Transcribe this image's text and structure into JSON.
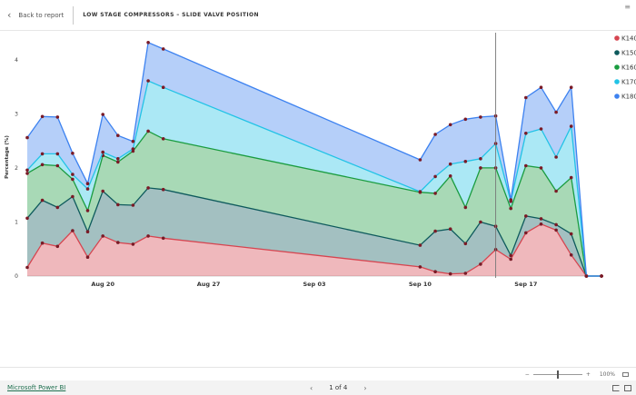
{
  "header": {
    "back_label": "Back to report",
    "title": "LOW STAGE COMPRESSORS – SLIDE VALVE POSITION"
  },
  "footer": {
    "brand_link": "Microsoft Power BI",
    "page_indicator": "1 of 4",
    "zoom_level": "100%"
  },
  "chart_data": {
    "type": "area",
    "stacked": true,
    "ylabel": "Percentage (%)",
    "xlabel": "",
    "ylim": [
      0,
      4.4
    ],
    "yticks": [
      0,
      1,
      2,
      3,
      4
    ],
    "x_ticks": [
      {
        "label": "Aug 20",
        "date": "2023-08-20"
      },
      {
        "label": "Aug 27",
        "date": "2023-08-27"
      },
      {
        "label": "Sep 03",
        "date": "2023-09-03"
      },
      {
        "label": "Sep 10",
        "date": "2023-09-10"
      },
      {
        "label": "Sep 17",
        "date": "2023-09-17"
      }
    ],
    "x": [
      "2023-08-15",
      "2023-08-16",
      "2023-08-17",
      "2023-08-18",
      "2023-08-19",
      "2023-08-20",
      "2023-08-21",
      "2023-08-22",
      "2023-08-23",
      "2023-08-24",
      "2023-09-10",
      "2023-09-11",
      "2023-09-12",
      "2023-09-13",
      "2023-09-14",
      "2023-09-15",
      "2023-09-16",
      "2023-09-17",
      "2023-09-18",
      "2023-09-19",
      "2023-09-20",
      "2023-09-21",
      "2023-09-22"
    ],
    "hover_date": "2023-09-15",
    "legend_position": "right",
    "grid": false,
    "series": [
      {
        "name": "K140",
        "color": "#d64550",
        "values": [
          0.16,
          0.61,
          0.55,
          0.84,
          0.35,
          0.74,
          0.62,
          0.59,
          0.74,
          0.7,
          0.17,
          0.08,
          0.04,
          0.05,
          0.22,
          0.49,
          0.31,
          0.8,
          0.96,
          0.85,
          0.39,
          0,
          0
        ]
      },
      {
        "name": "K150",
        "color": "#0e5a5c",
        "values": [
          0.91,
          0.79,
          0.72,
          0.63,
          0.47,
          0.83,
          0.7,
          0.72,
          0.89,
          0.9,
          0.4,
          0.75,
          0.83,
          0.55,
          0.78,
          0.43,
          0.07,
          0.31,
          0.1,
          0.1,
          0.39,
          0,
          0
        ]
      },
      {
        "name": "K160",
        "color": "#1a9c40",
        "values": [
          0.83,
          0.66,
          0.77,
          0.32,
          0.39,
          0.66,
          0.79,
          1.0,
          1.05,
          0.94,
          0.98,
          0.7,
          0.98,
          0.67,
          1.0,
          1.08,
          0.87,
          0.93,
          0.94,
          0.62,
          1.04,
          0,
          0
        ]
      },
      {
        "name": "K170",
        "color": "#22c3e6",
        "values": [
          0.06,
          0.2,
          0.22,
          0.09,
          0.4,
          0.06,
          0.06,
          0.04,
          0.93,
          0.95,
          0.01,
          0.31,
          0.22,
          0.85,
          0.17,
          0.45,
          0.13,
          0.6,
          0.72,
          0.63,
          0.95,
          0,
          0
        ]
      },
      {
        "name": "K180",
        "color": "#3d82f0",
        "values": [
          0.6,
          0.69,
          0.68,
          0.39,
          0.1,
          0.7,
          0.43,
          0.14,
          0.71,
          0.71,
          0.59,
          0.78,
          0.73,
          0.78,
          0.77,
          0.51,
          0.03,
          0.66,
          0.77,
          0.83,
          0.72,
          0,
          0
        ]
      }
    ]
  }
}
